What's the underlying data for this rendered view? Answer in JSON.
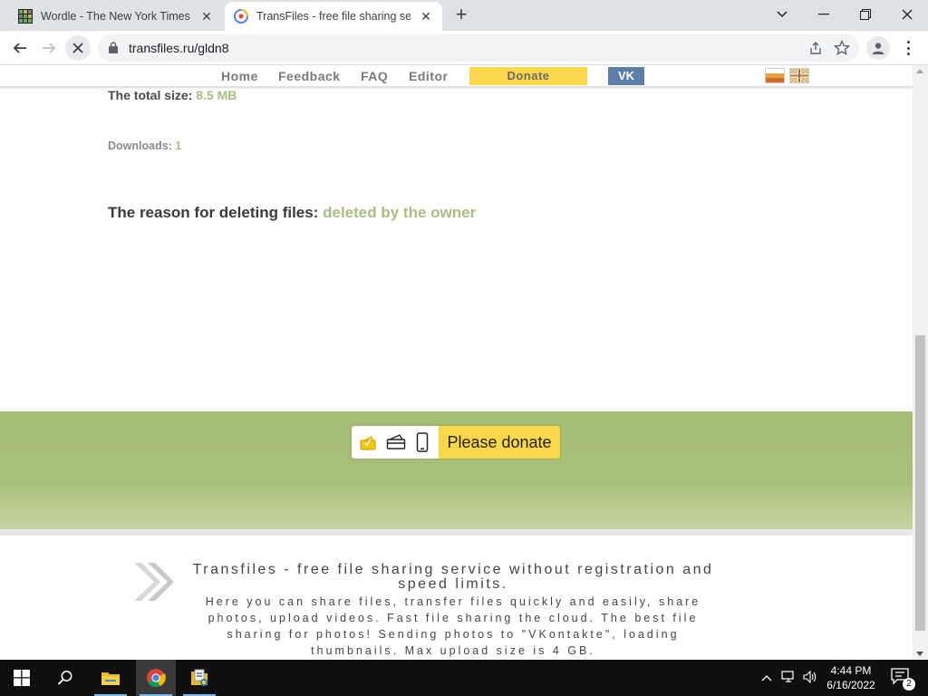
{
  "browser": {
    "tabs": [
      {
        "title": "Wordle - The New York Times",
        "active": false
      },
      {
        "title": "TransFiles - free file sharing servic",
        "active": true
      }
    ],
    "url": "transfiles.ru/gldn8"
  },
  "site_nav": {
    "links": [
      "Home",
      "Feedback",
      "FAQ",
      "Editor"
    ],
    "donate_label": "Donate",
    "vk_label": "VK"
  },
  "content": {
    "total_size_label": "The total size:",
    "total_size_value": "8.5 MB",
    "downloads_label": "Downloads:",
    "downloads_value": "1",
    "reason_label": "The reason for deleting files:",
    "reason_value": "deleted by the owner"
  },
  "donate_widget": {
    "button_label": "Please donate",
    "icons": [
      "wallet-icon",
      "card-icon",
      "phone-icon"
    ]
  },
  "footer": {
    "title": "Transfiles - free file sharing service without registration and speed limits.",
    "description": "Here you can share files, transfer files quickly and easily, share photos, upload videos. Fast file sharing the cloud. The best file sharing for photos! Sending photos to \"VKontakte\", loading thumbnails. Max upload size is 4 GB."
  },
  "taskbar": {
    "time": "4:44 PM",
    "date": "6/16/2022",
    "notification_count": "2"
  },
  "colors": {
    "accent_green": "#a8bd82",
    "band_green": "#a6bd74",
    "donate_yellow": "#fbd74a",
    "vk_blue": "#5b7fa6"
  }
}
